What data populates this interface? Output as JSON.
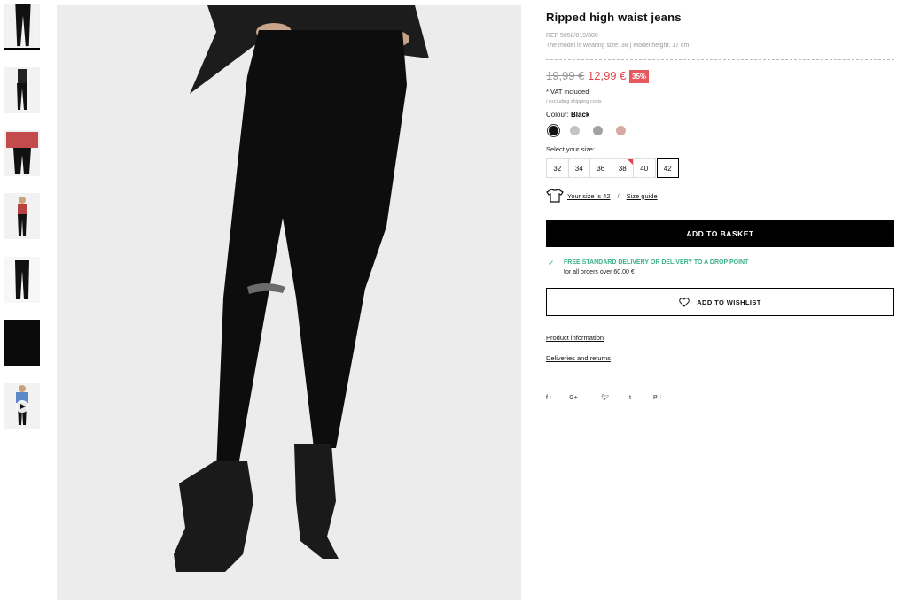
{
  "product": {
    "title": "Ripped high waist jeans",
    "ref": "REF 5058/019/800",
    "model_info": "The model is wearing size: 38 | Model height: 17 cm",
    "price_old": "19,99 €",
    "price_new": "12,99 €",
    "discount": "35%",
    "vat": "* VAT included",
    "shipping_note": "/ excluding shipping costs",
    "colour_label": "Colour:",
    "colour_value": "Black",
    "colours": [
      "#111111",
      "#bfbfbf",
      "#a3a3a3",
      "#d9a9a3"
    ],
    "size_label": "Select your size:",
    "sizes": [
      "32",
      "34",
      "36",
      "38",
      "40",
      "42"
    ],
    "selected_size": "42",
    "your_size": "Your size is 42",
    "size_guide": "Size guide",
    "add_to_basket": "ADD TO BASKET",
    "delivery_headline": "FREE STANDARD DELIVERY OR DELIVERY TO A DROP POINT",
    "delivery_sub": "for all orders over 60,00 €",
    "add_to_wishlist": "ADD TO WISHLIST",
    "product_information": "Product information",
    "deliveries_returns": "Deliveries and returns",
    "social": [
      "f",
      "G+",
      "t",
      "P"
    ]
  },
  "colors": {
    "accent_red": "#e0464b",
    "delivery_green": "#3ab08c",
    "button_black": "#000000"
  }
}
